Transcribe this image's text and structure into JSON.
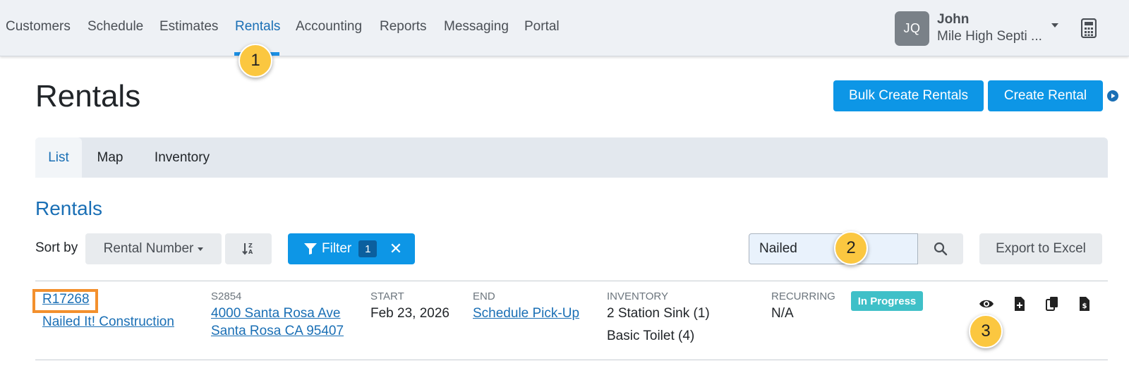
{
  "nav": {
    "items": [
      {
        "label": "Customers",
        "name": "nav-customers"
      },
      {
        "label": "Schedule",
        "name": "nav-schedule"
      },
      {
        "label": "Estimates",
        "name": "nav-estimates"
      },
      {
        "label": "Rentals",
        "name": "nav-rentals",
        "active": true
      },
      {
        "label": "Accounting",
        "name": "nav-accounting"
      },
      {
        "label": "Reports",
        "name": "nav-reports"
      },
      {
        "label": "Messaging",
        "name": "nav-messaging"
      },
      {
        "label": "Portal",
        "name": "nav-portal"
      }
    ]
  },
  "user": {
    "initials": "JQ",
    "name": "John",
    "company": "Mile High Septi ..."
  },
  "page": {
    "title": "Rentals",
    "bulk_create_label": "Bulk Create Rentals",
    "create_label": "Create Rental"
  },
  "tabs": [
    {
      "label": "List",
      "active": true
    },
    {
      "label": "Map"
    },
    {
      "label": "Inventory"
    }
  ],
  "section": {
    "title": "Rentals",
    "sort_label": "Sort by",
    "sort_value": "Rental Number",
    "filter_label": "Filter",
    "filter_count": "1",
    "search_value": "Nailed",
    "export_label": "Export to Excel"
  },
  "rental_row": {
    "rental_number": "R17268",
    "customer": "Nailed It! Construction",
    "site_code": "S2854",
    "address_line1": "4000 Santa Rosa Ave",
    "address_line2": "Santa Rosa CA 95407",
    "start_label": "START",
    "start_value": "Feb 23, 2026",
    "end_label": "END",
    "end_value": "Schedule Pick-Up",
    "inventory_label": "INVENTORY",
    "inventory_items": [
      "2 Station Sink (1)",
      "Basic Toilet (4)"
    ],
    "recurring_label": "RECURRING",
    "recurring_value": "N/A",
    "status": "In Progress"
  },
  "callouts": [
    "1",
    "2",
    "3"
  ],
  "colors": {
    "primary": "#0d96e6",
    "link": "#1a6fb5",
    "status_badge": "#3fc0c8",
    "highlight": "#f3902d",
    "callout": "#fbc740"
  }
}
